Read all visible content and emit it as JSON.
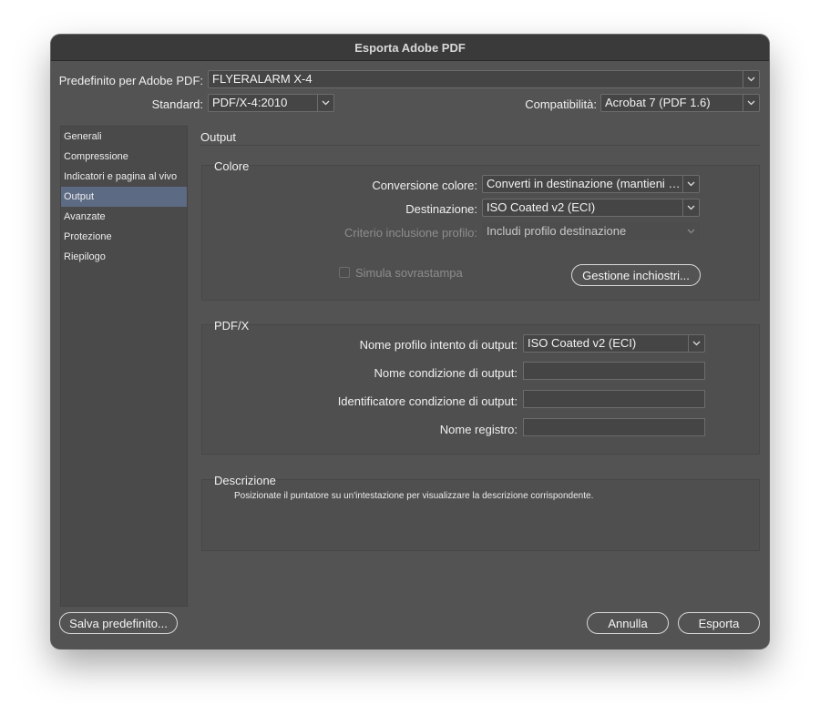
{
  "window": {
    "title": "Esporta Adobe PDF"
  },
  "preset": {
    "label": "Predefinito per Adobe PDF:",
    "value": "FLYERALARM X-4"
  },
  "standard": {
    "label": "Standard:",
    "value": "PDF/X-4:2010"
  },
  "compat": {
    "label": "Compatibilità:",
    "value": "Acrobat 7 (PDF 1.6)"
  },
  "sidebar": {
    "items": [
      {
        "label": "Generali"
      },
      {
        "label": "Compressione"
      },
      {
        "label": "Indicatori e pagina al vivo"
      },
      {
        "label": "Output"
      },
      {
        "label": "Avanzate"
      },
      {
        "label": "Protezione"
      },
      {
        "label": "Riepilogo"
      }
    ]
  },
  "main": {
    "section_title": "Output",
    "colore": {
      "title": "Colore",
      "conversion_label": "Conversione colore:",
      "conversion_value": "Converti in destinazione (mantieni valori numerici)",
      "dest_label": "Destinazione:",
      "dest_value": "ISO Coated v2 (ECI)",
      "profile_label": "Criterio inclusione profilo:",
      "profile_value": "Includi profilo destinazione",
      "simulate_label": "Simula sovrastampa",
      "ink_button": "Gestione inchiostri..."
    },
    "pdfx": {
      "title": "PDF/X",
      "intent_label": "Nome profilo intento di output:",
      "intent_value": "ISO Coated v2 (ECI)",
      "condition_label": "Nome condizione di output:",
      "condition_value": "",
      "identifier_label": "Identificatore condizione di output:",
      "identifier_value": "",
      "registry_label": "Nome registro:",
      "registry_value": ""
    },
    "descrizione": {
      "title": "Descrizione",
      "text": "Posizionate il puntatore su un'intestazione per visualizzare la descrizione corrispondente."
    }
  },
  "footer": {
    "save_preset": "Salva predefinito...",
    "cancel": "Annulla",
    "export": "Esporta"
  }
}
